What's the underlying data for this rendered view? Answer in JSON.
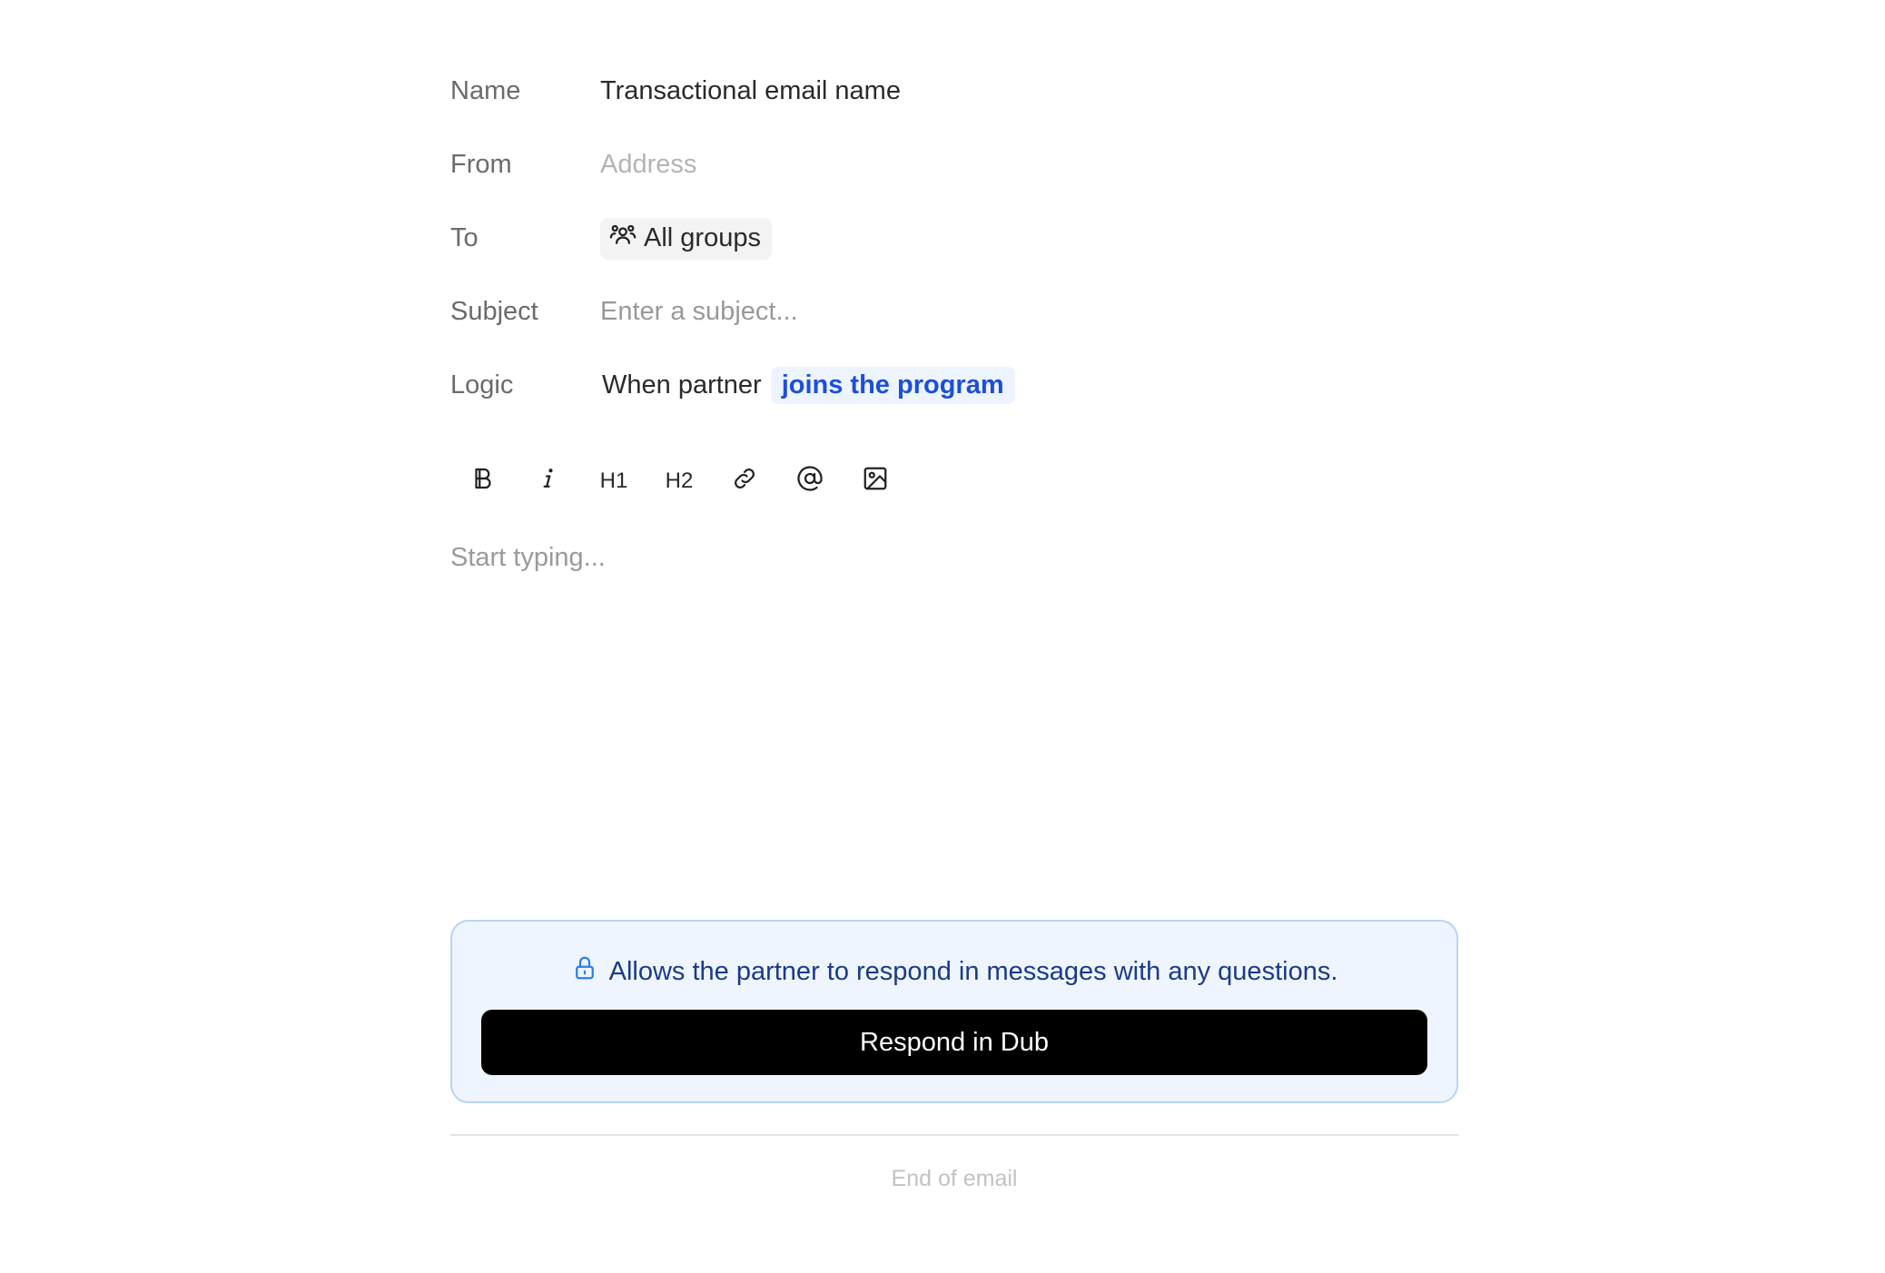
{
  "form": {
    "name_label": "Name",
    "name_value": "Transactional email name",
    "from_label": "From",
    "from_placeholder": "Address",
    "to_label": "To",
    "to_value": "All groups",
    "subject_label": "Subject",
    "subject_placeholder": "Enter a subject...",
    "logic_label": "Logic",
    "logic_prefix": "When partner",
    "logic_trigger": "joins the program"
  },
  "toolbar": {
    "items": [
      {
        "name": "bold",
        "icon": "bold-icon"
      },
      {
        "name": "italic",
        "icon": "italic-icon"
      },
      {
        "name": "h1",
        "label": "H1"
      },
      {
        "name": "h2",
        "label": "H2"
      },
      {
        "name": "link",
        "icon": "link-icon"
      },
      {
        "name": "mention",
        "icon": "at-icon"
      },
      {
        "name": "image",
        "icon": "image-icon"
      }
    ]
  },
  "editor": {
    "placeholder": "Start typing..."
  },
  "respond": {
    "message": "Allows the partner to respond in messages with any questions.",
    "button_label": "Respond in Dub",
    "accent": "#1b3a8a"
  },
  "footer": {
    "end_label": "End of email"
  }
}
